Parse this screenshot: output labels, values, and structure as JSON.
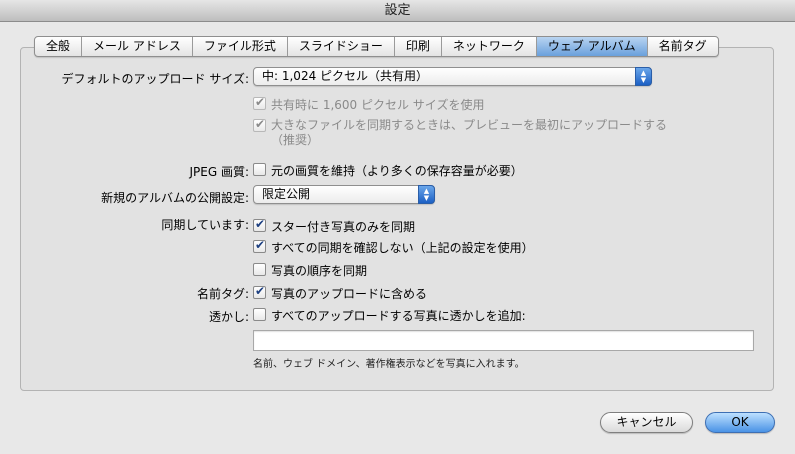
{
  "window": {
    "title": "設定"
  },
  "tabs": [
    {
      "label": "全般"
    },
    {
      "label": "メール アドレス"
    },
    {
      "label": "ファイル形式"
    },
    {
      "label": "スライドショー"
    },
    {
      "label": "印刷"
    },
    {
      "label": "ネットワーク"
    },
    {
      "label": "ウェブ アルバム",
      "active": true
    },
    {
      "label": "名前タグ"
    }
  ],
  "upload_size": {
    "label": "デフォルトのアップロード サイズ:",
    "value": "中: 1,024 ピクセル（共有用）"
  },
  "share_1600": {
    "label": "共有時に 1,600 ピクセル サイズを使用",
    "checked": true,
    "enabled": false
  },
  "preview_first": {
    "label_line1": "大きなファイルを同期するときは、プレビューを最初にアップロードする",
    "label_line2": "（推奨）",
    "checked": true,
    "enabled": false
  },
  "jpeg": {
    "label": "JPEG 画質:",
    "option": "元の画質を維持（より多くの保存容量が必要）",
    "checked": false
  },
  "album_visibility": {
    "label": "新規のアルバムの公開設定:",
    "value": "限定公開"
  },
  "sync": {
    "label": "同期しています:",
    "options": [
      {
        "label": "スター付き写真のみを同期",
        "checked": true
      },
      {
        "label": "すべての同期を確認しない（上記の設定を使用）",
        "checked": true
      },
      {
        "label": "写真の順序を同期",
        "checked": false
      }
    ]
  },
  "name_tags": {
    "label": "名前タグ:",
    "option": "写真のアップロードに含める",
    "checked": true
  },
  "watermark": {
    "label": "透かし:",
    "option": "すべてのアップロードする写真に透かしを追加:",
    "checked": false,
    "value": "",
    "hint": "名前、ウェブ ドメイン、著作権表示などを写真に入れます。"
  },
  "buttons": {
    "cancel": "キャンセル",
    "ok": "OK"
  }
}
